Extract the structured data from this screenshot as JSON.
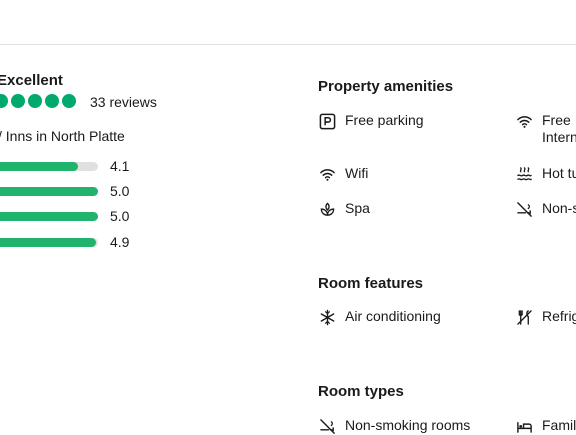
{
  "rating": {
    "label": "Excellent",
    "bubbles": 5,
    "reviews": "33 reviews",
    "ranking": "Inns in North Platte",
    "accent": "#00aa6c"
  },
  "subscores": [
    {
      "value": "4.1",
      "fill": 0.82
    },
    {
      "value": "5.0",
      "fill": 1.0
    },
    {
      "value": "5.0",
      "fill": 1.0
    },
    {
      "value": "4.9",
      "fill": 0.98
    }
  ],
  "property_amenities": {
    "title": "Property amenities",
    "items": [
      {
        "label": "Free parking",
        "icon": "parking-icon"
      },
      {
        "label": "Free",
        "label2": "Intern",
        "icon": "wifi-icon"
      },
      {
        "label": "Wifi",
        "icon": "wifi-icon"
      },
      {
        "label": "Hot tu",
        "icon": "hot-tub-icon"
      },
      {
        "label": "Spa",
        "icon": "spa-icon"
      },
      {
        "label": "Non-s",
        "icon": "no-smoking-icon"
      }
    ]
  },
  "room_features": {
    "title": "Room features",
    "items": [
      {
        "label": "Air conditioning",
        "icon": "snowflake-icon"
      },
      {
        "label": "Refrig",
        "icon": "refrigerator-icon"
      }
    ]
  },
  "room_types": {
    "title": "Room types",
    "items": [
      {
        "label": "Non-smoking rooms",
        "icon": "no-smoking-icon"
      },
      {
        "label": "Famil",
        "icon": "bed-icon"
      }
    ]
  }
}
